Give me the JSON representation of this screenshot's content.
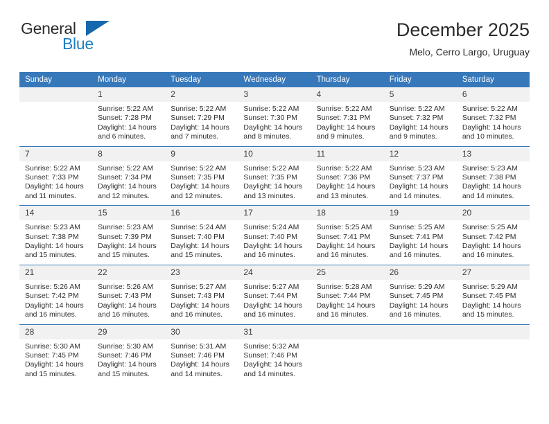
{
  "brand": {
    "name_top": "General",
    "name_bottom": "Blue",
    "accent_color": "#1668ae",
    "text_color": "#2b2b2b"
  },
  "header": {
    "title": "December 2025",
    "location": "Melo, Cerro Largo, Uruguay"
  },
  "calendar": {
    "header_bg": "#3778ba",
    "header_text_color": "#ffffff",
    "daynum_bg": "#f1f1f1",
    "weekdays": [
      "Sunday",
      "Monday",
      "Tuesday",
      "Wednesday",
      "Thursday",
      "Friday",
      "Saturday"
    ],
    "weeks": [
      [
        {
          "day": "",
          "empty": true,
          "sunrise": "",
          "sunset": "",
          "daylight": ""
        },
        {
          "day": "1",
          "sunrise": "Sunrise: 5:22 AM",
          "sunset": "Sunset: 7:28 PM",
          "daylight": "Daylight: 14 hours and 6 minutes."
        },
        {
          "day": "2",
          "sunrise": "Sunrise: 5:22 AM",
          "sunset": "Sunset: 7:29 PM",
          "daylight": "Daylight: 14 hours and 7 minutes."
        },
        {
          "day": "3",
          "sunrise": "Sunrise: 5:22 AM",
          "sunset": "Sunset: 7:30 PM",
          "daylight": "Daylight: 14 hours and 8 minutes."
        },
        {
          "day": "4",
          "sunrise": "Sunrise: 5:22 AM",
          "sunset": "Sunset: 7:31 PM",
          "daylight": "Daylight: 14 hours and 9 minutes."
        },
        {
          "day": "5",
          "sunrise": "Sunrise: 5:22 AM",
          "sunset": "Sunset: 7:32 PM",
          "daylight": "Daylight: 14 hours and 9 minutes."
        },
        {
          "day": "6",
          "sunrise": "Sunrise: 5:22 AM",
          "sunset": "Sunset: 7:32 PM",
          "daylight": "Daylight: 14 hours and 10 minutes."
        }
      ],
      [
        {
          "day": "7",
          "sunrise": "Sunrise: 5:22 AM",
          "sunset": "Sunset: 7:33 PM",
          "daylight": "Daylight: 14 hours and 11 minutes."
        },
        {
          "day": "8",
          "sunrise": "Sunrise: 5:22 AM",
          "sunset": "Sunset: 7:34 PM",
          "daylight": "Daylight: 14 hours and 12 minutes."
        },
        {
          "day": "9",
          "sunrise": "Sunrise: 5:22 AM",
          "sunset": "Sunset: 7:35 PM",
          "daylight": "Daylight: 14 hours and 12 minutes."
        },
        {
          "day": "10",
          "sunrise": "Sunrise: 5:22 AM",
          "sunset": "Sunset: 7:35 PM",
          "daylight": "Daylight: 14 hours and 13 minutes."
        },
        {
          "day": "11",
          "sunrise": "Sunrise: 5:22 AM",
          "sunset": "Sunset: 7:36 PM",
          "daylight": "Daylight: 14 hours and 13 minutes."
        },
        {
          "day": "12",
          "sunrise": "Sunrise: 5:23 AM",
          "sunset": "Sunset: 7:37 PM",
          "daylight": "Daylight: 14 hours and 14 minutes."
        },
        {
          "day": "13",
          "sunrise": "Sunrise: 5:23 AM",
          "sunset": "Sunset: 7:38 PM",
          "daylight": "Daylight: 14 hours and 14 minutes."
        }
      ],
      [
        {
          "day": "14",
          "sunrise": "Sunrise: 5:23 AM",
          "sunset": "Sunset: 7:38 PM",
          "daylight": "Daylight: 14 hours and 15 minutes."
        },
        {
          "day": "15",
          "sunrise": "Sunrise: 5:23 AM",
          "sunset": "Sunset: 7:39 PM",
          "daylight": "Daylight: 14 hours and 15 minutes."
        },
        {
          "day": "16",
          "sunrise": "Sunrise: 5:24 AM",
          "sunset": "Sunset: 7:40 PM",
          "daylight": "Daylight: 14 hours and 15 minutes."
        },
        {
          "day": "17",
          "sunrise": "Sunrise: 5:24 AM",
          "sunset": "Sunset: 7:40 PM",
          "daylight": "Daylight: 14 hours and 16 minutes."
        },
        {
          "day": "18",
          "sunrise": "Sunrise: 5:25 AM",
          "sunset": "Sunset: 7:41 PM",
          "daylight": "Daylight: 14 hours and 16 minutes."
        },
        {
          "day": "19",
          "sunrise": "Sunrise: 5:25 AM",
          "sunset": "Sunset: 7:41 PM",
          "daylight": "Daylight: 14 hours and 16 minutes."
        },
        {
          "day": "20",
          "sunrise": "Sunrise: 5:25 AM",
          "sunset": "Sunset: 7:42 PM",
          "daylight": "Daylight: 14 hours and 16 minutes."
        }
      ],
      [
        {
          "day": "21",
          "sunrise": "Sunrise: 5:26 AM",
          "sunset": "Sunset: 7:42 PM",
          "daylight": "Daylight: 14 hours and 16 minutes."
        },
        {
          "day": "22",
          "sunrise": "Sunrise: 5:26 AM",
          "sunset": "Sunset: 7:43 PM",
          "daylight": "Daylight: 14 hours and 16 minutes."
        },
        {
          "day": "23",
          "sunrise": "Sunrise: 5:27 AM",
          "sunset": "Sunset: 7:43 PM",
          "daylight": "Daylight: 14 hours and 16 minutes."
        },
        {
          "day": "24",
          "sunrise": "Sunrise: 5:27 AM",
          "sunset": "Sunset: 7:44 PM",
          "daylight": "Daylight: 14 hours and 16 minutes."
        },
        {
          "day": "25",
          "sunrise": "Sunrise: 5:28 AM",
          "sunset": "Sunset: 7:44 PM",
          "daylight": "Daylight: 14 hours and 16 minutes."
        },
        {
          "day": "26",
          "sunrise": "Sunrise: 5:29 AM",
          "sunset": "Sunset: 7:45 PM",
          "daylight": "Daylight: 14 hours and 16 minutes."
        },
        {
          "day": "27",
          "sunrise": "Sunrise: 5:29 AM",
          "sunset": "Sunset: 7:45 PM",
          "daylight": "Daylight: 14 hours and 15 minutes."
        }
      ],
      [
        {
          "day": "28",
          "sunrise": "Sunrise: 5:30 AM",
          "sunset": "Sunset: 7:45 PM",
          "daylight": "Daylight: 14 hours and 15 minutes."
        },
        {
          "day": "29",
          "sunrise": "Sunrise: 5:30 AM",
          "sunset": "Sunset: 7:46 PM",
          "daylight": "Daylight: 14 hours and 15 minutes."
        },
        {
          "day": "30",
          "sunrise": "Sunrise: 5:31 AM",
          "sunset": "Sunset: 7:46 PM",
          "daylight": "Daylight: 14 hours and 14 minutes."
        },
        {
          "day": "31",
          "sunrise": "Sunrise: 5:32 AM",
          "sunset": "Sunset: 7:46 PM",
          "daylight": "Daylight: 14 hours and 14 minutes."
        },
        {
          "day": "",
          "empty": true,
          "sunrise": "",
          "sunset": "",
          "daylight": ""
        },
        {
          "day": "",
          "empty": true,
          "sunrise": "",
          "sunset": "",
          "daylight": ""
        },
        {
          "day": "",
          "empty": true,
          "sunrise": "",
          "sunset": "",
          "daylight": ""
        }
      ]
    ]
  }
}
